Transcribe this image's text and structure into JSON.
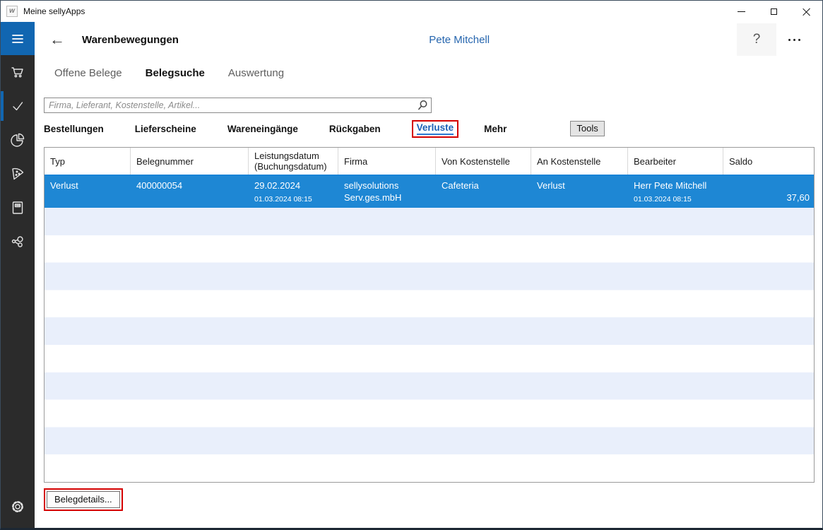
{
  "colors": {
    "accent": "#1166b1",
    "selected-row": "#1e87d4",
    "stripe": "#e9effb",
    "highlight-red": "#d40000",
    "link-blue": "#1b5fb5",
    "user-blue": "#2565ae",
    "header-underline": "#1883d7"
  },
  "window": {
    "title": "Meine sellyApps",
    "app_icon_glyph": "w",
    "controls": [
      "minimize-icon",
      "maximize-icon",
      "close-icon"
    ]
  },
  "sidebar": {
    "icons": [
      "hamburger-icon",
      "cart-icon",
      "check-icon",
      "pie-chart-icon",
      "pizza-icon",
      "book-icon",
      "share-icon",
      "gear-icon"
    ],
    "active_item": "check"
  },
  "header": {
    "title": "Warenbewegungen",
    "user": "Pete Mitchell",
    "help_label": "?"
  },
  "tabs": [
    {
      "label": "Offene Belege",
      "active": false
    },
    {
      "label": "Belegsuche",
      "active": true
    },
    {
      "label": "Auswertung",
      "active": false
    }
  ],
  "search": {
    "placeholder": "Firma, Lieferant, Kostenstelle, Artikel..."
  },
  "filters": {
    "items": [
      {
        "label": "Bestellungen"
      },
      {
        "label": "Lieferscheine"
      },
      {
        "label": "Wareneingänge"
      },
      {
        "label": "Rückgaben"
      },
      {
        "label": "Verluste",
        "selected": true,
        "highlighted": true
      },
      {
        "label": "Mehr"
      }
    ],
    "tools_label": "Tools"
  },
  "table": {
    "columns": [
      "Typ",
      "Belegnummer",
      "Leistungsdatum (Buchungsdatum)",
      "Firma",
      "Von Kostenstelle",
      "An Kostenstelle",
      "Bearbeiter",
      "Saldo"
    ],
    "rows": [
      {
        "typ": "Verlust",
        "belegnummer": "400000054",
        "leistungsdatum": "29.02.2024",
        "buchungsdatum": "01.03.2024 08:15",
        "firma": "sellysolutions Serv.ges.mbH",
        "von_kostenstelle": "Cafeteria",
        "an_kostenstelle": "Verlust",
        "bearbeiter": "Herr Pete Mitchell",
        "bearbeiter_datum": "01.03.2024 08:15",
        "saldo": "37,60",
        "selected": true
      }
    ]
  },
  "footer": {
    "details_button": "Belegdetails..."
  }
}
